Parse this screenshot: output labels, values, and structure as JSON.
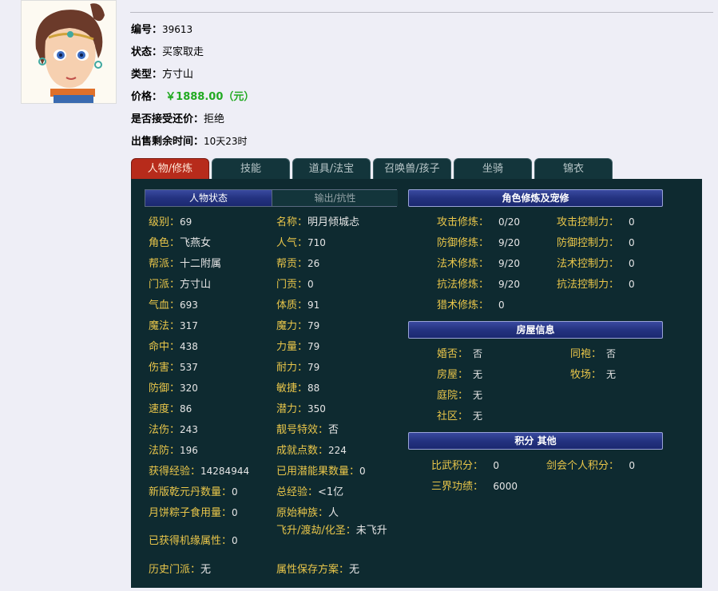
{
  "item": {
    "id_label": "编号：",
    "id_value": "39613",
    "status_label": "状态：",
    "status_value": "买家取走",
    "type_label": "类型：",
    "type_value": "方寸山",
    "price_label": "价格：",
    "price_value": "￥1888.00（元）",
    "bargain_label": "是否接受还价：",
    "bargain_value": "拒绝",
    "remaining_label": "出售剩余时间：",
    "remaining_value": "10天23时"
  },
  "tabs": [
    "人物/修炼",
    "技能",
    "道具/法宝",
    "召唤兽/孩子",
    "坐骑",
    "锦衣"
  ],
  "subtabs": [
    "人物状态",
    "输出/抗性"
  ],
  "character": {
    "left": [
      {
        "label": "级别：",
        "value": "69"
      },
      {
        "label": "角色：",
        "value": "飞燕女"
      },
      {
        "label": "帮派：",
        "value": "十二附属"
      },
      {
        "label": "门派：",
        "value": "方寸山"
      },
      {
        "label": "气血：",
        "value": "693"
      },
      {
        "label": "魔法：",
        "value": "317"
      },
      {
        "label": "命中：",
        "value": "438"
      },
      {
        "label": "伤害：",
        "value": "537"
      },
      {
        "label": "防御：",
        "value": "320"
      },
      {
        "label": "速度：",
        "value": "86"
      },
      {
        "label": "法伤：",
        "value": "243"
      },
      {
        "label": "法防：",
        "value": "196"
      },
      {
        "label": "获得经验：",
        "value": "14284944"
      },
      {
        "label": "新版乾元丹数量：",
        "value": "0"
      },
      {
        "label": "月饼粽子食用量：",
        "value": "0"
      },
      {
        "label": "已获得机缘属性：",
        "value": "0"
      },
      {
        "label": "历史门派：",
        "value": "无"
      }
    ],
    "right": [
      {
        "label": "名称：",
        "value": "明月倾城忐"
      },
      {
        "label": "人气：",
        "value": "710"
      },
      {
        "label": "帮贡：",
        "value": "26"
      },
      {
        "label": "门贡：",
        "value": "0"
      },
      {
        "label": "体质：",
        "value": "91"
      },
      {
        "label": "魔力：",
        "value": "79"
      },
      {
        "label": "力量：",
        "value": "79"
      },
      {
        "label": "耐力：",
        "value": "79"
      },
      {
        "label": "敏捷：",
        "value": "88"
      },
      {
        "label": "潜力：",
        "value": "350"
      },
      {
        "label": "靓号特效：",
        "value": "否"
      },
      {
        "label": "成就点数：",
        "value": "224"
      },
      {
        "label": "已用潜能果数量：",
        "value": "0"
      },
      {
        "label": "总经验：",
        "value": "<1亿"
      },
      {
        "label": "原始种族：",
        "value": "人"
      },
      {
        "label": "飞升/渡劫/化圣：",
        "value": "未飞升"
      },
      {
        "label": "属性保存方案：",
        "value": "无"
      }
    ]
  },
  "cultivation": {
    "title": "角色修炼及宠修",
    "left": [
      {
        "label": "攻击修炼：",
        "value": "0/20"
      },
      {
        "label": "防御修炼：",
        "value": "9/20"
      },
      {
        "label": "法术修炼：",
        "value": "9/20"
      },
      {
        "label": "抗法修炼：",
        "value": "9/20"
      },
      {
        "label": "猎术修炼：",
        "value": "0"
      }
    ],
    "right": [
      {
        "label": "攻击控制力：",
        "value": "0"
      },
      {
        "label": "防御控制力：",
        "value": "0"
      },
      {
        "label": "法术控制力：",
        "value": "0"
      },
      {
        "label": "抗法控制力：",
        "value": "0"
      }
    ]
  },
  "house": {
    "title": "房屋信息",
    "left": [
      {
        "label": "婚否：",
        "value": "否"
      },
      {
        "label": "房屋：",
        "value": "无"
      },
      {
        "label": "庭院：",
        "value": "无"
      },
      {
        "label": "社区：",
        "value": "无"
      }
    ],
    "right": [
      {
        "label": "同袍：",
        "value": "否"
      },
      {
        "label": "牧场：",
        "value": "无"
      }
    ]
  },
  "points": {
    "title": "积分 其他",
    "rows": [
      {
        "label": "比武积分：",
        "value": "0"
      },
      {
        "label": "剑会个人积分：",
        "value": "0"
      },
      {
        "label": "三界功绩：",
        "value": "6000"
      }
    ]
  },
  "colors": {
    "panel_bg": "#0e2a30",
    "label_gold": "#e9c64a",
    "active_tab": "#b72b1b",
    "price_green": "#22aa22",
    "header_blue": "#243380"
  }
}
